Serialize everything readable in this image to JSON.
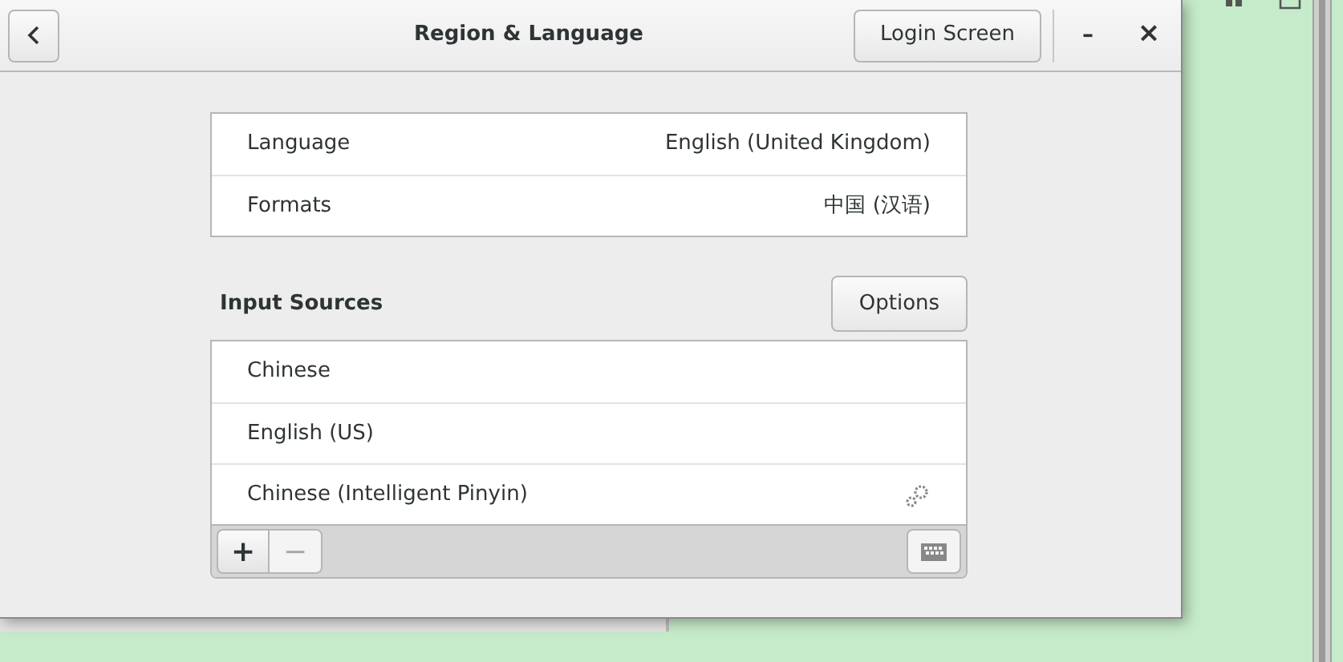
{
  "window": {
    "title": "Region & Language",
    "header_button": "Login Screen",
    "minimize": "–",
    "close": "×"
  },
  "settings": [
    {
      "label": "Language",
      "value": "English (United Kingdom)"
    },
    {
      "label": "Formats",
      "value": "中国 (汉语)"
    }
  ],
  "input_sources": {
    "heading": "Input Sources",
    "options_button": "Options",
    "items": [
      {
        "name": "Chinese",
        "has_settings": false
      },
      {
        "name": "English (US)",
        "has_settings": false
      },
      {
        "name": "Chinese (Intelligent Pinyin)",
        "has_settings": true
      }
    ],
    "add": {
      "label": "+",
      "disabled": false
    },
    "remove": {
      "label": "−",
      "disabled": true
    }
  }
}
